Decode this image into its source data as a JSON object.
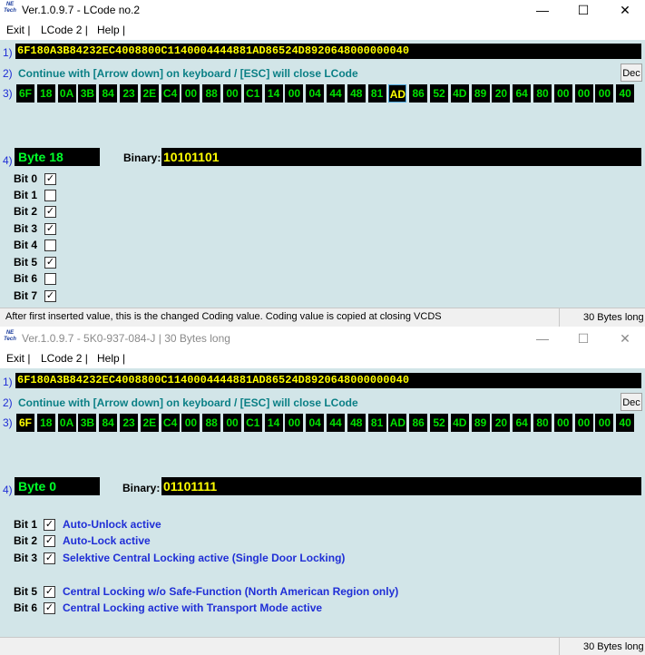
{
  "window1": {
    "app_logo": "NE Tech",
    "title": "Ver.1.0.9.7 - LCode no.2",
    "minimize_icon": "minimize-icon",
    "maximize_icon": "maximize-icon",
    "close_icon": "close-icon",
    "menu": [
      "Exit |",
      "LCode 2 |",
      "Help |"
    ],
    "row1_label": "1)",
    "coding_value": "6F180A3B84232EC4008800C1140004444881AD86524D8920648000000040",
    "row2_label": "2)",
    "info": "Continue with [Arrow down] on keyboard / [ESC] will close LCode",
    "dec_button": "Dec",
    "row3_label": "3)",
    "bytes": [
      "6F",
      "18",
      "0A",
      "3B",
      "84",
      "23",
      "2E",
      "C4",
      "00",
      "88",
      "00",
      "C1",
      "14",
      "00",
      "04",
      "44",
      "48",
      "81",
      "AD",
      "86",
      "52",
      "4D",
      "89",
      "20",
      "64",
      "80",
      "00",
      "00",
      "00",
      "40"
    ],
    "selected_byte_index": 18,
    "row4_label": "4)",
    "byte_label": "Byte 18",
    "binary_label": "Binary:",
    "binary_value": "10101101",
    "bits": [
      {
        "label": "Bit 0",
        "checked": true
      },
      {
        "label": "Bit 1",
        "checked": false
      },
      {
        "label": "Bit 2",
        "checked": true
      },
      {
        "label": "Bit 3",
        "checked": true
      },
      {
        "label": "Bit 4",
        "checked": false
      },
      {
        "label": "Bit 5",
        "checked": true
      },
      {
        "label": "Bit 6",
        "checked": false
      },
      {
        "label": "Bit 7",
        "checked": true
      }
    ],
    "status_text": "After first inserted value, this is the changed Coding value.  Coding value is copied at closing VCDS",
    "status_right": "30 Bytes long"
  },
  "window2": {
    "app_logo": "NE Tech",
    "title": "Ver.1.0.9.7 -   5K0-937-084-J | 30 Bytes long",
    "menu": [
      "Exit |",
      "LCode 2 |",
      "Help |"
    ],
    "row1_label": "1)",
    "coding_value": "6F180A3B84232EC4008800C1140004444881AD86524D8920648000000040",
    "row2_label": "2)",
    "info": "Continue with [Arrow down] on keyboard / [ESC] will close LCode",
    "dec_button": "Dec",
    "row3_label": "3)",
    "bytes": [
      "6F",
      "18",
      "0A",
      "3B",
      "84",
      "23",
      "2E",
      "C4",
      "00",
      "88",
      "00",
      "C1",
      "14",
      "00",
      "04",
      "44",
      "48",
      "81",
      "AD",
      "86",
      "52",
      "4D",
      "89",
      "20",
      "64",
      "80",
      "00",
      "00",
      "00",
      "40"
    ],
    "selected_byte_index": 0,
    "row4_label": "4)",
    "byte_label": "Byte 0",
    "binary_label": "Binary:",
    "binary_value": "01101111",
    "bits": [
      {
        "label": "Bit 1",
        "checked": true,
        "desc": "Auto-Unlock active"
      },
      {
        "label": "Bit 2",
        "checked": true,
        "desc": "Auto-Lock active"
      },
      {
        "label": "Bit 3",
        "checked": true,
        "desc": "Selektive Central Locking active (Single Door Locking)"
      },
      {
        "label": "Bit 5",
        "checked": true,
        "desc": "Central Locking w/o Safe-Function (North American Region only)"
      },
      {
        "label": "Bit 6",
        "checked": true,
        "desc": "Central Locking active with Transport Mode active"
      }
    ],
    "status_right": "30 Bytes long"
  },
  "colors": {
    "window_bg": "#d2e5e8",
    "byte_text": "#00e000",
    "selected_byte_text": "#ffff00",
    "info_text": "#0a7f85",
    "bit_desc_text": "#1f2ed6"
  }
}
